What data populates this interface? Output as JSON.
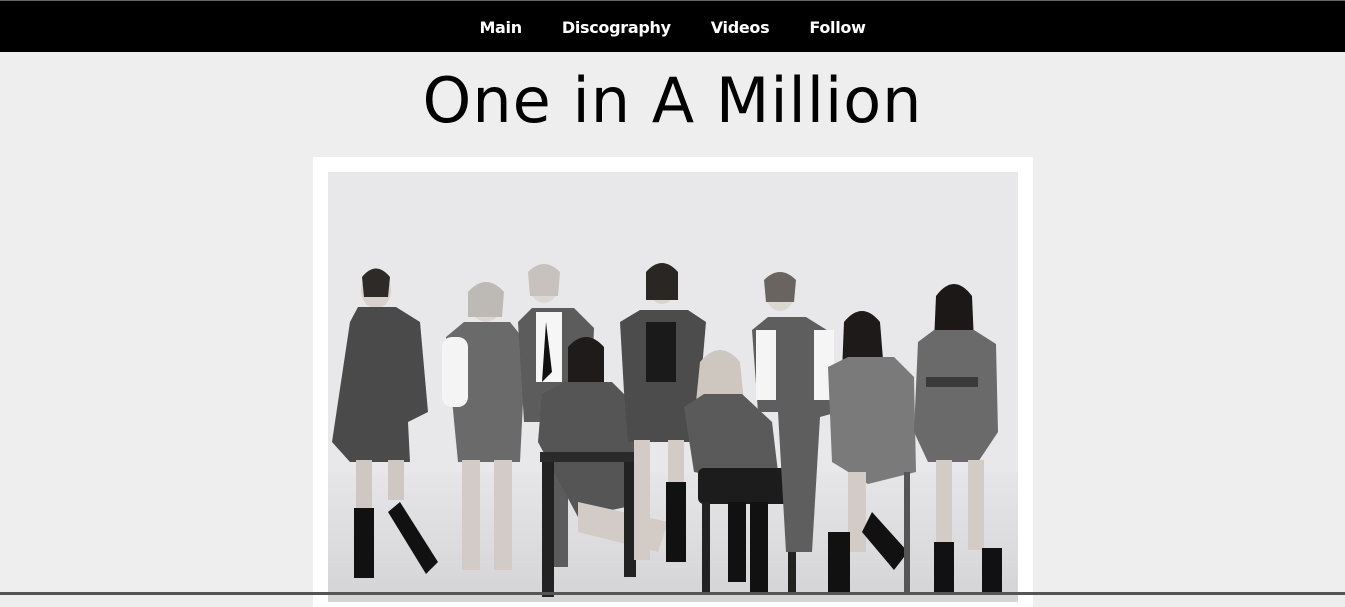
{
  "nav": {
    "items": [
      {
        "label": "Main"
      },
      {
        "label": "Discography"
      },
      {
        "label": "Videos"
      },
      {
        "label": "Follow"
      }
    ]
  },
  "page": {
    "title": "One in A Million"
  },
  "colors": {
    "nav_background": "#000000",
    "nav_text": "#ffffff",
    "page_background": "#eeeeee",
    "frame": "#ffffff",
    "title_text": "#000000"
  }
}
